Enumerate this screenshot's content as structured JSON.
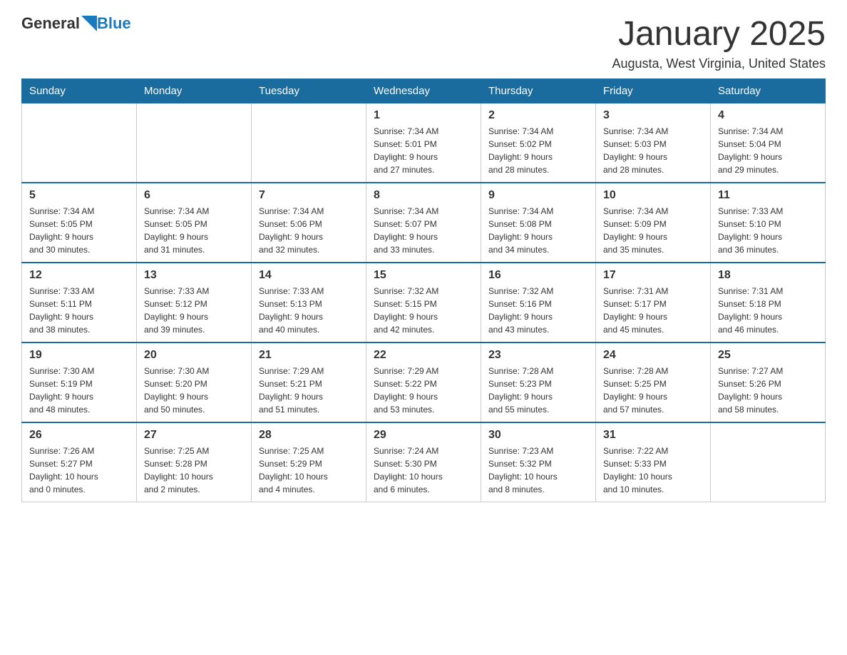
{
  "header": {
    "logo_general": "General",
    "logo_blue": "Blue",
    "month_title": "January 2025",
    "location": "Augusta, West Virginia, United States"
  },
  "weekdays": [
    "Sunday",
    "Monday",
    "Tuesday",
    "Wednesday",
    "Thursday",
    "Friday",
    "Saturday"
  ],
  "weeks": [
    [
      {
        "day": "",
        "info": ""
      },
      {
        "day": "",
        "info": ""
      },
      {
        "day": "",
        "info": ""
      },
      {
        "day": "1",
        "info": "Sunrise: 7:34 AM\nSunset: 5:01 PM\nDaylight: 9 hours\nand 27 minutes."
      },
      {
        "day": "2",
        "info": "Sunrise: 7:34 AM\nSunset: 5:02 PM\nDaylight: 9 hours\nand 28 minutes."
      },
      {
        "day": "3",
        "info": "Sunrise: 7:34 AM\nSunset: 5:03 PM\nDaylight: 9 hours\nand 28 minutes."
      },
      {
        "day": "4",
        "info": "Sunrise: 7:34 AM\nSunset: 5:04 PM\nDaylight: 9 hours\nand 29 minutes."
      }
    ],
    [
      {
        "day": "5",
        "info": "Sunrise: 7:34 AM\nSunset: 5:05 PM\nDaylight: 9 hours\nand 30 minutes."
      },
      {
        "day": "6",
        "info": "Sunrise: 7:34 AM\nSunset: 5:05 PM\nDaylight: 9 hours\nand 31 minutes."
      },
      {
        "day": "7",
        "info": "Sunrise: 7:34 AM\nSunset: 5:06 PM\nDaylight: 9 hours\nand 32 minutes."
      },
      {
        "day": "8",
        "info": "Sunrise: 7:34 AM\nSunset: 5:07 PM\nDaylight: 9 hours\nand 33 minutes."
      },
      {
        "day": "9",
        "info": "Sunrise: 7:34 AM\nSunset: 5:08 PM\nDaylight: 9 hours\nand 34 minutes."
      },
      {
        "day": "10",
        "info": "Sunrise: 7:34 AM\nSunset: 5:09 PM\nDaylight: 9 hours\nand 35 minutes."
      },
      {
        "day": "11",
        "info": "Sunrise: 7:33 AM\nSunset: 5:10 PM\nDaylight: 9 hours\nand 36 minutes."
      }
    ],
    [
      {
        "day": "12",
        "info": "Sunrise: 7:33 AM\nSunset: 5:11 PM\nDaylight: 9 hours\nand 38 minutes."
      },
      {
        "day": "13",
        "info": "Sunrise: 7:33 AM\nSunset: 5:12 PM\nDaylight: 9 hours\nand 39 minutes."
      },
      {
        "day": "14",
        "info": "Sunrise: 7:33 AM\nSunset: 5:13 PM\nDaylight: 9 hours\nand 40 minutes."
      },
      {
        "day": "15",
        "info": "Sunrise: 7:32 AM\nSunset: 5:15 PM\nDaylight: 9 hours\nand 42 minutes."
      },
      {
        "day": "16",
        "info": "Sunrise: 7:32 AM\nSunset: 5:16 PM\nDaylight: 9 hours\nand 43 minutes."
      },
      {
        "day": "17",
        "info": "Sunrise: 7:31 AM\nSunset: 5:17 PM\nDaylight: 9 hours\nand 45 minutes."
      },
      {
        "day": "18",
        "info": "Sunrise: 7:31 AM\nSunset: 5:18 PM\nDaylight: 9 hours\nand 46 minutes."
      }
    ],
    [
      {
        "day": "19",
        "info": "Sunrise: 7:30 AM\nSunset: 5:19 PM\nDaylight: 9 hours\nand 48 minutes."
      },
      {
        "day": "20",
        "info": "Sunrise: 7:30 AM\nSunset: 5:20 PM\nDaylight: 9 hours\nand 50 minutes."
      },
      {
        "day": "21",
        "info": "Sunrise: 7:29 AM\nSunset: 5:21 PM\nDaylight: 9 hours\nand 51 minutes."
      },
      {
        "day": "22",
        "info": "Sunrise: 7:29 AM\nSunset: 5:22 PM\nDaylight: 9 hours\nand 53 minutes."
      },
      {
        "day": "23",
        "info": "Sunrise: 7:28 AM\nSunset: 5:23 PM\nDaylight: 9 hours\nand 55 minutes."
      },
      {
        "day": "24",
        "info": "Sunrise: 7:28 AM\nSunset: 5:25 PM\nDaylight: 9 hours\nand 57 minutes."
      },
      {
        "day": "25",
        "info": "Sunrise: 7:27 AM\nSunset: 5:26 PM\nDaylight: 9 hours\nand 58 minutes."
      }
    ],
    [
      {
        "day": "26",
        "info": "Sunrise: 7:26 AM\nSunset: 5:27 PM\nDaylight: 10 hours\nand 0 minutes."
      },
      {
        "day": "27",
        "info": "Sunrise: 7:25 AM\nSunset: 5:28 PM\nDaylight: 10 hours\nand 2 minutes."
      },
      {
        "day": "28",
        "info": "Sunrise: 7:25 AM\nSunset: 5:29 PM\nDaylight: 10 hours\nand 4 minutes."
      },
      {
        "day": "29",
        "info": "Sunrise: 7:24 AM\nSunset: 5:30 PM\nDaylight: 10 hours\nand 6 minutes."
      },
      {
        "day": "30",
        "info": "Sunrise: 7:23 AM\nSunset: 5:32 PM\nDaylight: 10 hours\nand 8 minutes."
      },
      {
        "day": "31",
        "info": "Sunrise: 7:22 AM\nSunset: 5:33 PM\nDaylight: 10 hours\nand 10 minutes."
      },
      {
        "day": "",
        "info": ""
      }
    ]
  ]
}
